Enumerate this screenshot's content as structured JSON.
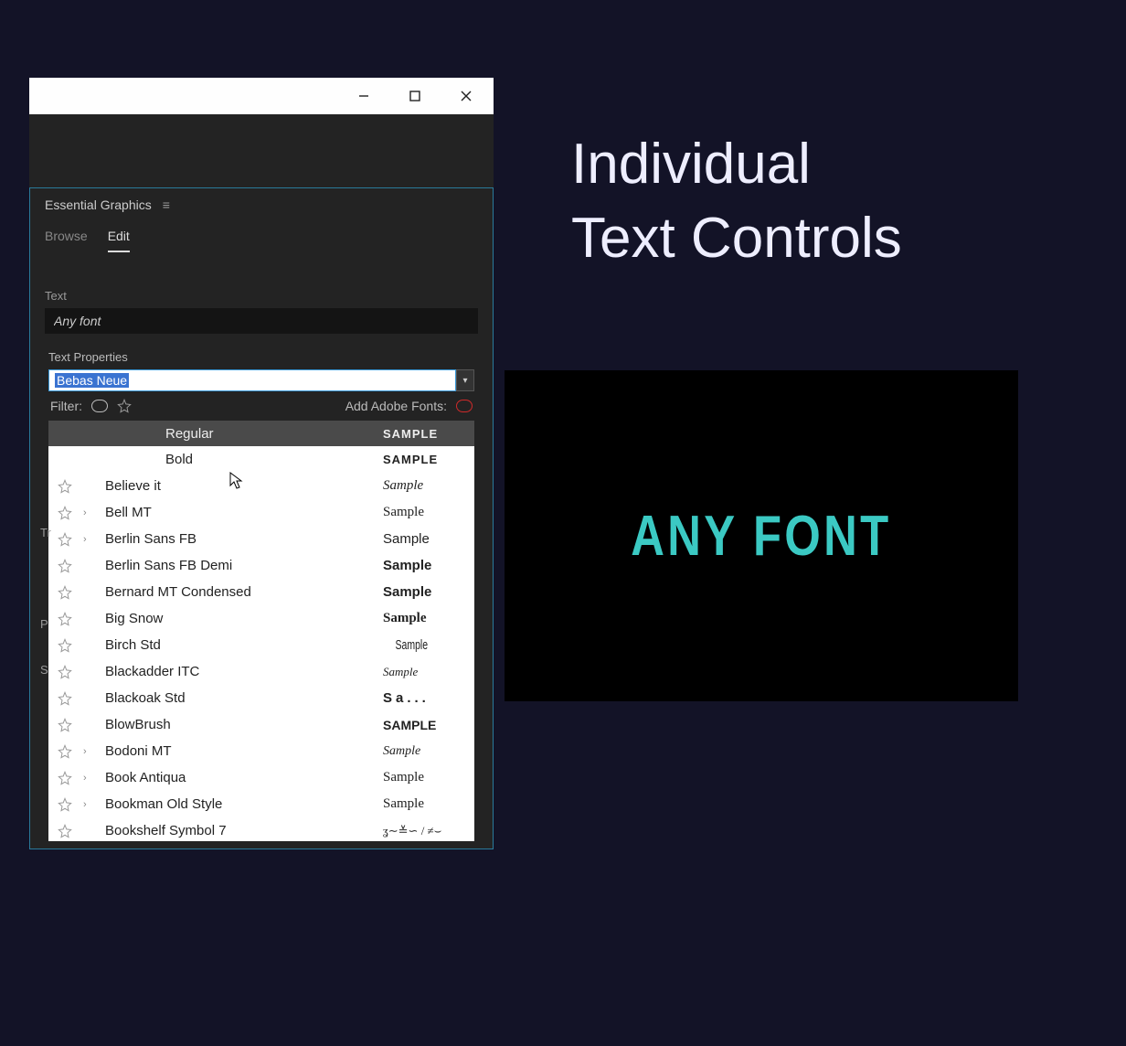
{
  "headline_line1": "Individual",
  "headline_line2": "Text Controls",
  "window": {
    "panel_title": "Essential Graphics",
    "tabs": {
      "browse": "Browse",
      "edit": "Edit"
    },
    "section_text": "Text",
    "text_value": "Any font",
    "text_properties": "Text Properties",
    "font_selected": "Bebas Neue",
    "filter_label": "Filter:",
    "add_fonts_label": "Add Adobe Fonts:"
  },
  "font_weights": [
    {
      "name": "Regular",
      "sample": "SAMPLE",
      "style": "font-family:Arial;font-weight:600;letter-spacing:1px;font-size:13px"
    },
    {
      "name": "Bold",
      "sample": "SAMPLE",
      "style": "font-family:Arial;font-weight:800;letter-spacing:1px;font-size:13px"
    }
  ],
  "fonts": [
    {
      "name": "Believe it",
      "expand": false,
      "sample": "Sample",
      "style": "font-family:'Brush Script MT',cursive;font-style:italic"
    },
    {
      "name": "Bell MT",
      "expand": true,
      "sample": "Sample",
      "style": "font-family:'Times New Roman',serif"
    },
    {
      "name": "Berlin Sans FB",
      "expand": true,
      "sample": "Sample",
      "style": "font-family:'Verdana',sans-serif"
    },
    {
      "name": "Berlin Sans FB Demi",
      "expand": false,
      "sample": "Sample",
      "style": "font-family:'Verdana',sans-serif;font-weight:700"
    },
    {
      "name": "Bernard MT Condensed",
      "expand": false,
      "sample": "Sample",
      "style": "font-family:'Arial Narrow',sans-serif;font-weight:800"
    },
    {
      "name": "Big Snow",
      "expand": false,
      "sample": "Sample",
      "style": "font-family:'Brush Script MT',cursive;font-weight:600"
    },
    {
      "name": "Birch Std",
      "expand": false,
      "sample": "Sample",
      "style": "font-family:'Arial Narrow',sans-serif;transform:scaleX(0.7);display:inline-block"
    },
    {
      "name": "Blackadder ITC",
      "expand": false,
      "sample": "Sample",
      "style": "font-family:cursive;font-style:italic;font-size:13px"
    },
    {
      "name": "Blackoak Std",
      "expand": false,
      "sample": "Sa...",
      "style": "font-family:Impact,sans-serif;letter-spacing:4px;font-weight:900"
    },
    {
      "name": "BlowBrush",
      "expand": false,
      "sample": "SAMPLE",
      "style": "font-family:Arial;font-weight:900;font-size:14px"
    },
    {
      "name": "Bodoni MT",
      "expand": true,
      "sample": "Sample",
      "style": "font-family:'Times New Roman',serif;font-style:italic;font-size:14px"
    },
    {
      "name": "Book Antiqua",
      "expand": true,
      "sample": "Sample",
      "style": "font-family:'Book Antiqua','Palatino',serif"
    },
    {
      "name": "Bookman Old Style",
      "expand": true,
      "sample": "Sample",
      "style": "font-family:'Bookman Old Style',serif"
    },
    {
      "name": "Bookshelf Symbol 7",
      "expand": false,
      "sample": "ʓ∼≚∽ / ≠⌣",
      "style": "font-family:serif;font-size:13px"
    }
  ],
  "side": {
    "tr": "Tr",
    "p": "P",
    "s": "S"
  },
  "preview_text": "ANY FONT"
}
